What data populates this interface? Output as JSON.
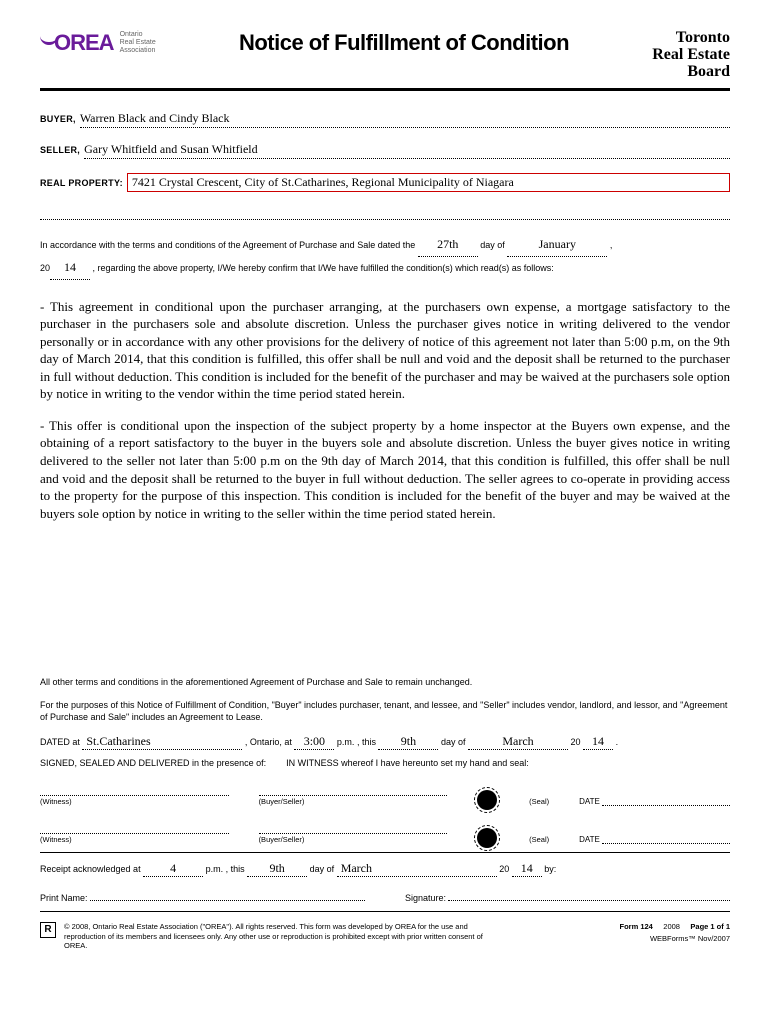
{
  "header": {
    "logo_text": "OREA",
    "logo_sub1": "Ontario",
    "logo_sub2": "Real Estate",
    "logo_sub3": "Association",
    "title": "Notice of Fulfillment of Condition",
    "treb1": "Toronto",
    "treb2": "Real Estate",
    "treb3": "Board"
  },
  "fields": {
    "buyer_label": "BUYER,",
    "buyer_value": "Warren Black and Cindy Black",
    "seller_label": "SELLER,",
    "seller_value": "Gary Whitfield and Susan Whitfield",
    "property_label": "REAL PROPERTY:",
    "property_value": "7421 Crystal Crescent, City of St.Catharines, Regional Municipality of Niagara"
  },
  "accordance": {
    "pre": "In accordance with the terms and conditions of the Agreement of Purchase and Sale dated the ",
    "day": "27th",
    "dayof": " day of ",
    "month": "January",
    "comma": ",",
    "yr_pre": "20",
    "yr": "14",
    "post": ", regarding the above property, I/We hereby confirm that I/We have fulfilled the condition(s) which read(s) as follows:"
  },
  "conditions": {
    "p1": "- This agreement in conditional upon the purchaser arranging, at the purchasers own expense, a mortgage satisfactory to the purchaser in the purchasers sole and absolute discretion. Unless the purchaser gives notice in writing delivered to the vendor personally or in accordance with any other provisions for the delivery of notice of this agreement not later than 5:00 p.m, on the 9th day of March 2014, that this condition is fulfilled, this offer shall be null and void and the deposit shall be returned to the purchaser in full without deduction. This condition is included for the benefit of the purchaser and may be waived at the purchasers sole option by notice in writing to the vendor within the time period stated herein.",
    "p2": "- This offer is conditional upon the inspection of the subject property by a home inspector at the Buyers own expense, and the obtaining of a report satisfactory to the buyer in the buyers sole and absolute discretion. Unless the buyer gives notice in writing delivered to the seller not later than 5:00 p.m on the 9th day of March 2014, that this condition is fulfilled, this offer shall be null and void and the deposit shall be returned to the buyer in full without deduction. The seller agrees to co-operate in providing access to the property for the purpose of this inspection. This condition is included for the benefit of the buyer and may be waived at the buyers sole option by notice in writing to the seller within the time period stated herein."
  },
  "terms": {
    "unchanged": "All other terms and conditions in the aforementioned Agreement of Purchase and Sale to remain unchanged.",
    "purposes": "For the purposes of this Notice of Fulfillment of Condition, \"Buyer\" includes purchaser, tenant, and lessee, and \"Seller\" includes vendor, landlord, and lessor, and \"Agreement of Purchase and Sale\" includes an Agreement to Lease."
  },
  "dated": {
    "pre": "DATED at ",
    "city": "St.Catharines",
    "ontario": ", Ontario, at ",
    "time": "3:00",
    "pm": " p.m.",
    "this": ", this ",
    "day": "9th",
    "dayof": " day of ",
    "month": "March",
    "yr_pre": " 20",
    "yr": "14",
    "dot": " .",
    "signed": "SIGNED, SEALED AND DELIVERED in the presence of:",
    "witness": "IN WITNESS whereof I have hereunto set my hand and seal:"
  },
  "sig": {
    "witness": "(Witness)",
    "buyerseller": "(Buyer/Seller)",
    "seal": "(Seal)",
    "date": "DATE"
  },
  "receipt": {
    "pre": "Receipt acknowledged at ",
    "time": "4",
    "pm": " p.m.",
    "this": ", this ",
    "day": "9th",
    "dayof": " day of ",
    "month": "March",
    "yr_pre": " 20",
    "yr": "14",
    "by": " by:",
    "print": "Print Name:",
    "signature": "Signature:"
  },
  "footer": {
    "realtor": "R",
    "copyright": "© 2008, Ontario Real Estate Association (\"OREA\"). All rights reserved. This form was developed by OREA for the use and reproduction of its members and licensees only. Any other use or reproduction is prohibited except with prior written consent of OREA.",
    "form": "Form 124",
    "year": "2008",
    "page": "Page 1 of 1",
    "webforms": "WEBForms™ Nov/2007"
  }
}
